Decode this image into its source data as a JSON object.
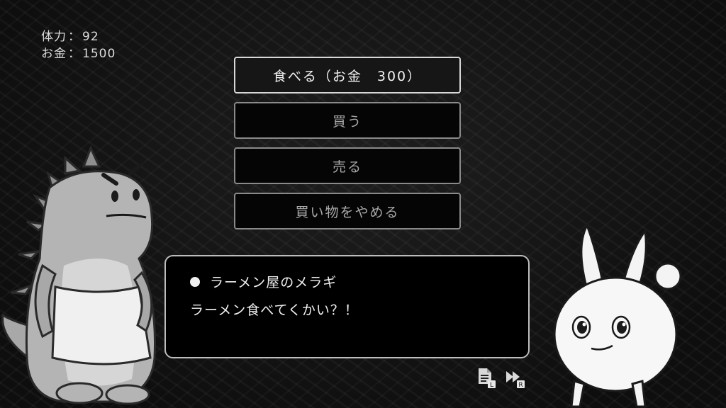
{
  "stats": {
    "stamina_label": "体力",
    "stamina_value": "92",
    "money_label": "お金",
    "money_value": "1500",
    "separator": "："
  },
  "menu": {
    "items": [
      {
        "label": "食べる（お金　300）",
        "selected": true
      },
      {
        "label": "買う",
        "selected": false
      },
      {
        "label": "売る",
        "selected": false
      },
      {
        "label": "買い物をやめる",
        "selected": false
      }
    ]
  },
  "dialog": {
    "speaker": "ラーメン屋のメラギ",
    "message": "ラーメン食べてくかい？！"
  },
  "controls": {
    "log_icon": "log-icon",
    "log_key": "L",
    "fastforward_icon": "fast-forward-icon",
    "fastforward_key": "R"
  },
  "colors": {
    "background": "#121212",
    "button_border": "#8a8a8a",
    "button_border_selected": "#d8d8d8",
    "text": "#f0f0f0"
  }
}
